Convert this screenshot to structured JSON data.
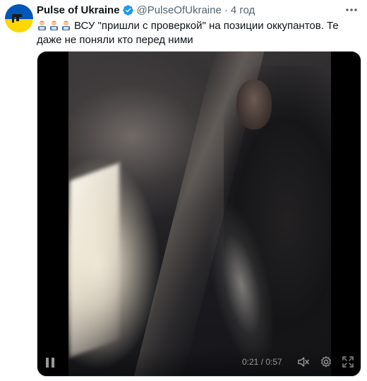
{
  "tweet": {
    "author": {
      "display_name": "Pulse of Ukraine",
      "handle": "@PulseOfUkraine",
      "verified": true,
      "avatar_icon": "ukraine-flag-avatar-icon"
    },
    "separator": "·",
    "timestamp": "4 год",
    "emojis": [
      "man-technologist-icon",
      "man-technologist-icon",
      "man-technologist-icon"
    ],
    "text": "ВСУ \"пришли с проверкой\" на позиции оккупантов. Те даже не поняли кто перед ними",
    "more_icon": "more-horizontal-icon"
  },
  "video": {
    "current_time": "0:21",
    "time_separator": " / ",
    "duration": "0:57",
    "play_icon": "pause-icon",
    "volume_icon": "volume-muted-icon",
    "settings_icon": "gear-icon",
    "fullscreen_icon": "fullscreen-icon"
  },
  "colors": {
    "verified_blue": "#1d9bf0",
    "secondary_text": "#536471",
    "flag_blue": "#0057b7",
    "flag_yellow": "#ffd700"
  }
}
